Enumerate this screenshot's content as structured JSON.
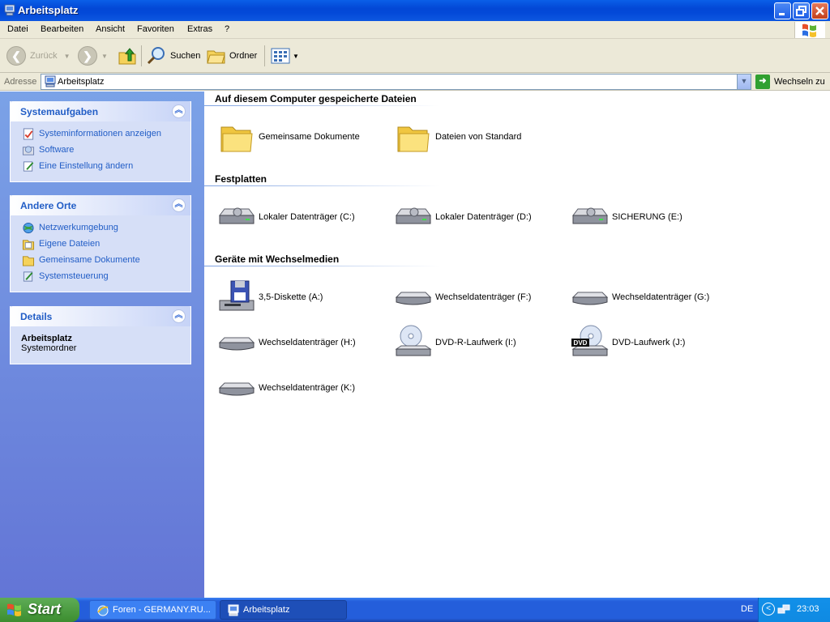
{
  "window": {
    "title": "Arbeitsplatz"
  },
  "menu": [
    "Datei",
    "Bearbeiten",
    "Ansicht",
    "Favoriten",
    "Extras",
    "?"
  ],
  "toolbar": {
    "back_label": "Zurück",
    "search_label": "Suchen",
    "folders_label": "Ordner"
  },
  "address": {
    "label": "Adresse",
    "value": "Arbeitsplatz",
    "go_label": "Wechseln zu"
  },
  "sidebar": {
    "panels": [
      {
        "title": "Systemaufgaben",
        "items": [
          {
            "label": "Systeminformationen anzeigen",
            "icon": "system-info-icon"
          },
          {
            "label": "Software",
            "icon": "software-icon"
          },
          {
            "label": "Eine Einstellung ändern",
            "icon": "settings-icon"
          }
        ]
      },
      {
        "title": "Andere Orte",
        "items": [
          {
            "label": "Netzwerkumgebung",
            "icon": "network-icon"
          },
          {
            "label": "Eigene Dateien",
            "icon": "my-documents-icon"
          },
          {
            "label": "Gemeinsame Dokumente",
            "icon": "folder-icon"
          },
          {
            "label": "Systemsteuerung",
            "icon": "control-panel-icon"
          }
        ]
      },
      {
        "title": "Details",
        "name": "Arbeitsplatz",
        "type": "Systemordner"
      }
    ]
  },
  "sections": [
    {
      "title": "Auf diesem Computer gespeicherte Dateien",
      "items": [
        {
          "label": "Gemeinsame Dokumente",
          "icon": "folder-icon"
        },
        {
          "label": "Dateien von Standard",
          "icon": "folder-icon"
        }
      ]
    },
    {
      "title": "Festplatten",
      "items": [
        {
          "label": "Lokaler Datenträger (C:)",
          "icon": "hard-drive-icon"
        },
        {
          "label": "Lokaler Datenträger (D:)",
          "icon": "hard-drive-icon"
        },
        {
          "label": "SICHERUNG (E:)",
          "icon": "hard-drive-icon"
        }
      ]
    },
    {
      "title": "Geräte mit Wechselmedien",
      "items": [
        {
          "label": "3,5-Diskette (A:)",
          "icon": "floppy-drive-icon"
        },
        {
          "label": "Wechseldatenträger (F:)",
          "icon": "removable-drive-icon"
        },
        {
          "label": "Wechseldatenträger (G:)",
          "icon": "removable-drive-icon"
        },
        {
          "label": "Wechseldatenträger (H:)",
          "icon": "removable-drive-icon"
        },
        {
          "label": "DVD-R-Laufwerk (I:)",
          "icon": "dvd-r-drive-icon"
        },
        {
          "label": "DVD-Laufwerk (J:)",
          "icon": "dvd-drive-icon"
        },
        {
          "label": "Wechseldatenträger (K:)",
          "icon": "removable-drive-icon"
        }
      ]
    }
  ],
  "dvd_badge": "DVD",
  "taskbar": {
    "start_label": "Start",
    "tasks": [
      {
        "label": "Foren - GERMANY.RU...",
        "icon": "internet-explorer-icon"
      },
      {
        "label": "Arbeitsplatz",
        "icon": "my-computer-icon"
      }
    ],
    "language": "DE",
    "clock": "23:03"
  },
  "colors": {
    "titlebar": "#0348d6",
    "sidebar_link": "#215dc6",
    "taskbar": "#245edb",
    "start_button": "#3c8d2f"
  }
}
